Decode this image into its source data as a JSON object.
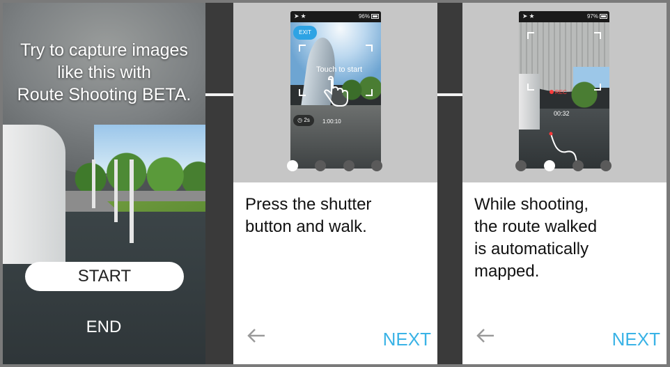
{
  "intro": {
    "title_line1": "Try to capture images",
    "title_line2": "like this with",
    "title_line3": "Route Shooting BETA.",
    "start_label": "START",
    "end_label": "END"
  },
  "step1": {
    "status_right": "96%",
    "exit_label": "EXIT",
    "touch_text": "Touch to start",
    "interval_label": "2s",
    "timer_value": "1:00:10",
    "description_line1": "Press the shutter",
    "description_line2": "button and walk.",
    "next_label": "NEXT",
    "active_page": 1,
    "page_count": 4
  },
  "step2": {
    "status_right": "97%",
    "rec_label": "REC",
    "rec_time": "00:32",
    "description_line1": "While shooting,",
    "description_line2": "the route walked",
    "description_line3": "is automatically",
    "description_line4": "mapped.",
    "next_label": "NEXT",
    "active_page": 2,
    "page_count": 4
  },
  "colors": {
    "accent_blue": "#3ab3e6",
    "exit_blue": "#2ea3e4",
    "rec_red": "#ff3b3b"
  },
  "icons": {
    "back": "back-arrow-icon",
    "hand": "hand-pointer-icon",
    "status_left": "location-icon"
  }
}
